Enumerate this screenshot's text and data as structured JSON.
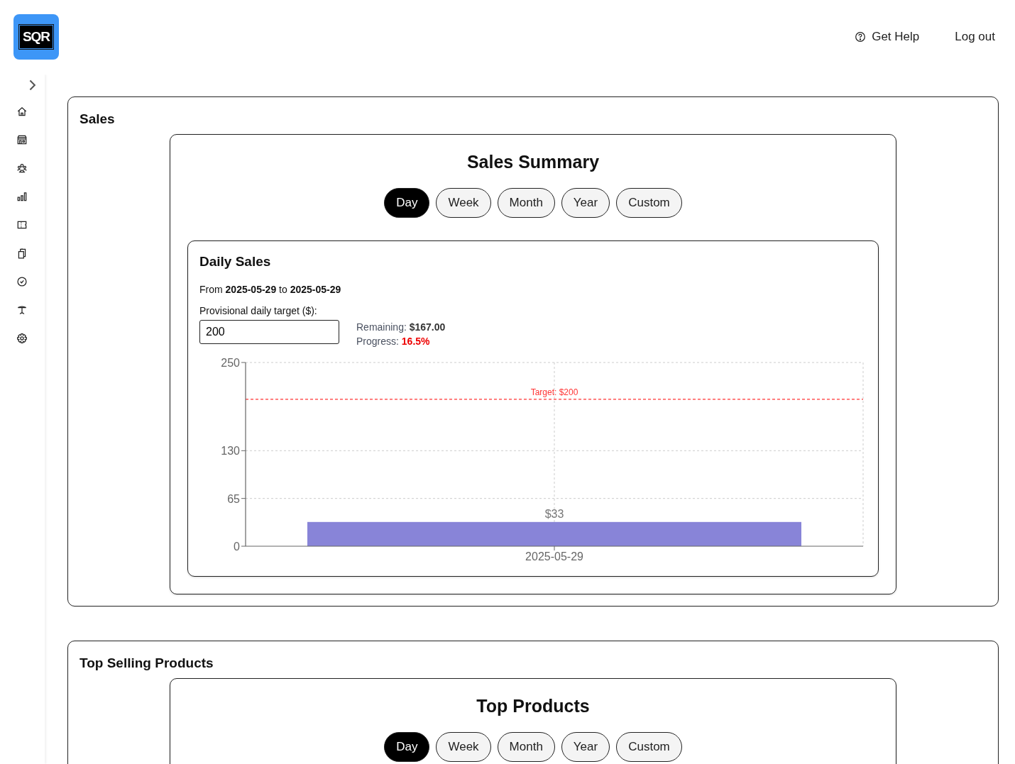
{
  "header": {
    "logo": {
      "text": "SQR"
    },
    "links": [
      {
        "label": "Get Help"
      },
      {
        "label": "Log out"
      }
    ]
  },
  "sections": [
    {
      "title": "Sales",
      "card": {
        "title": "Sales Summary",
        "tabs": [
          {
            "label": "Day",
            "selected": true
          },
          {
            "label": "Week",
            "selected": false
          },
          {
            "label": "Month",
            "selected": false
          },
          {
            "label": "Year",
            "selected": false
          },
          {
            "label": "Custom",
            "selected": false
          }
        ],
        "panel": {
          "title": "Daily Sales",
          "range": "From **2025-05-29** to **2025-05-29**",
          "target_label": "Provisional daily target ($):",
          "target_value": "200",
          "remaining": "Remaining: **$167.00**",
          "progress_label": "Progress: ",
          "progress_value": "16.5%",
          "chart_data": {
            "type": "bar",
            "categories": [
              "2025-05-29"
            ],
            "series": [
              {
                "color": "#8884d8",
                "values": [
                  33
                ]
              }
            ],
            "ylim": [
              0,
              250
            ],
            "yticks": [
              0,
              65,
              130,
              250
            ],
            "grid": true,
            "value_labels": [
              "$33"
            ],
            "ref_lines": [
              {
                "axis": "y",
                "value": 200,
                "label": "Target: $200",
                "color": "#ff3333"
              }
            ]
          }
        }
      }
    },
    {
      "title": "Top Selling Products",
      "card": {
        "title": "Top Products",
        "tabs": [
          {
            "label": "Day",
            "selected": true
          },
          {
            "label": "Week",
            "selected": false
          },
          {
            "label": "Month",
            "selected": false
          },
          {
            "label": "Year",
            "selected": false
          },
          {
            "label": "Custom",
            "selected": false
          }
        ]
      }
    }
  ]
}
